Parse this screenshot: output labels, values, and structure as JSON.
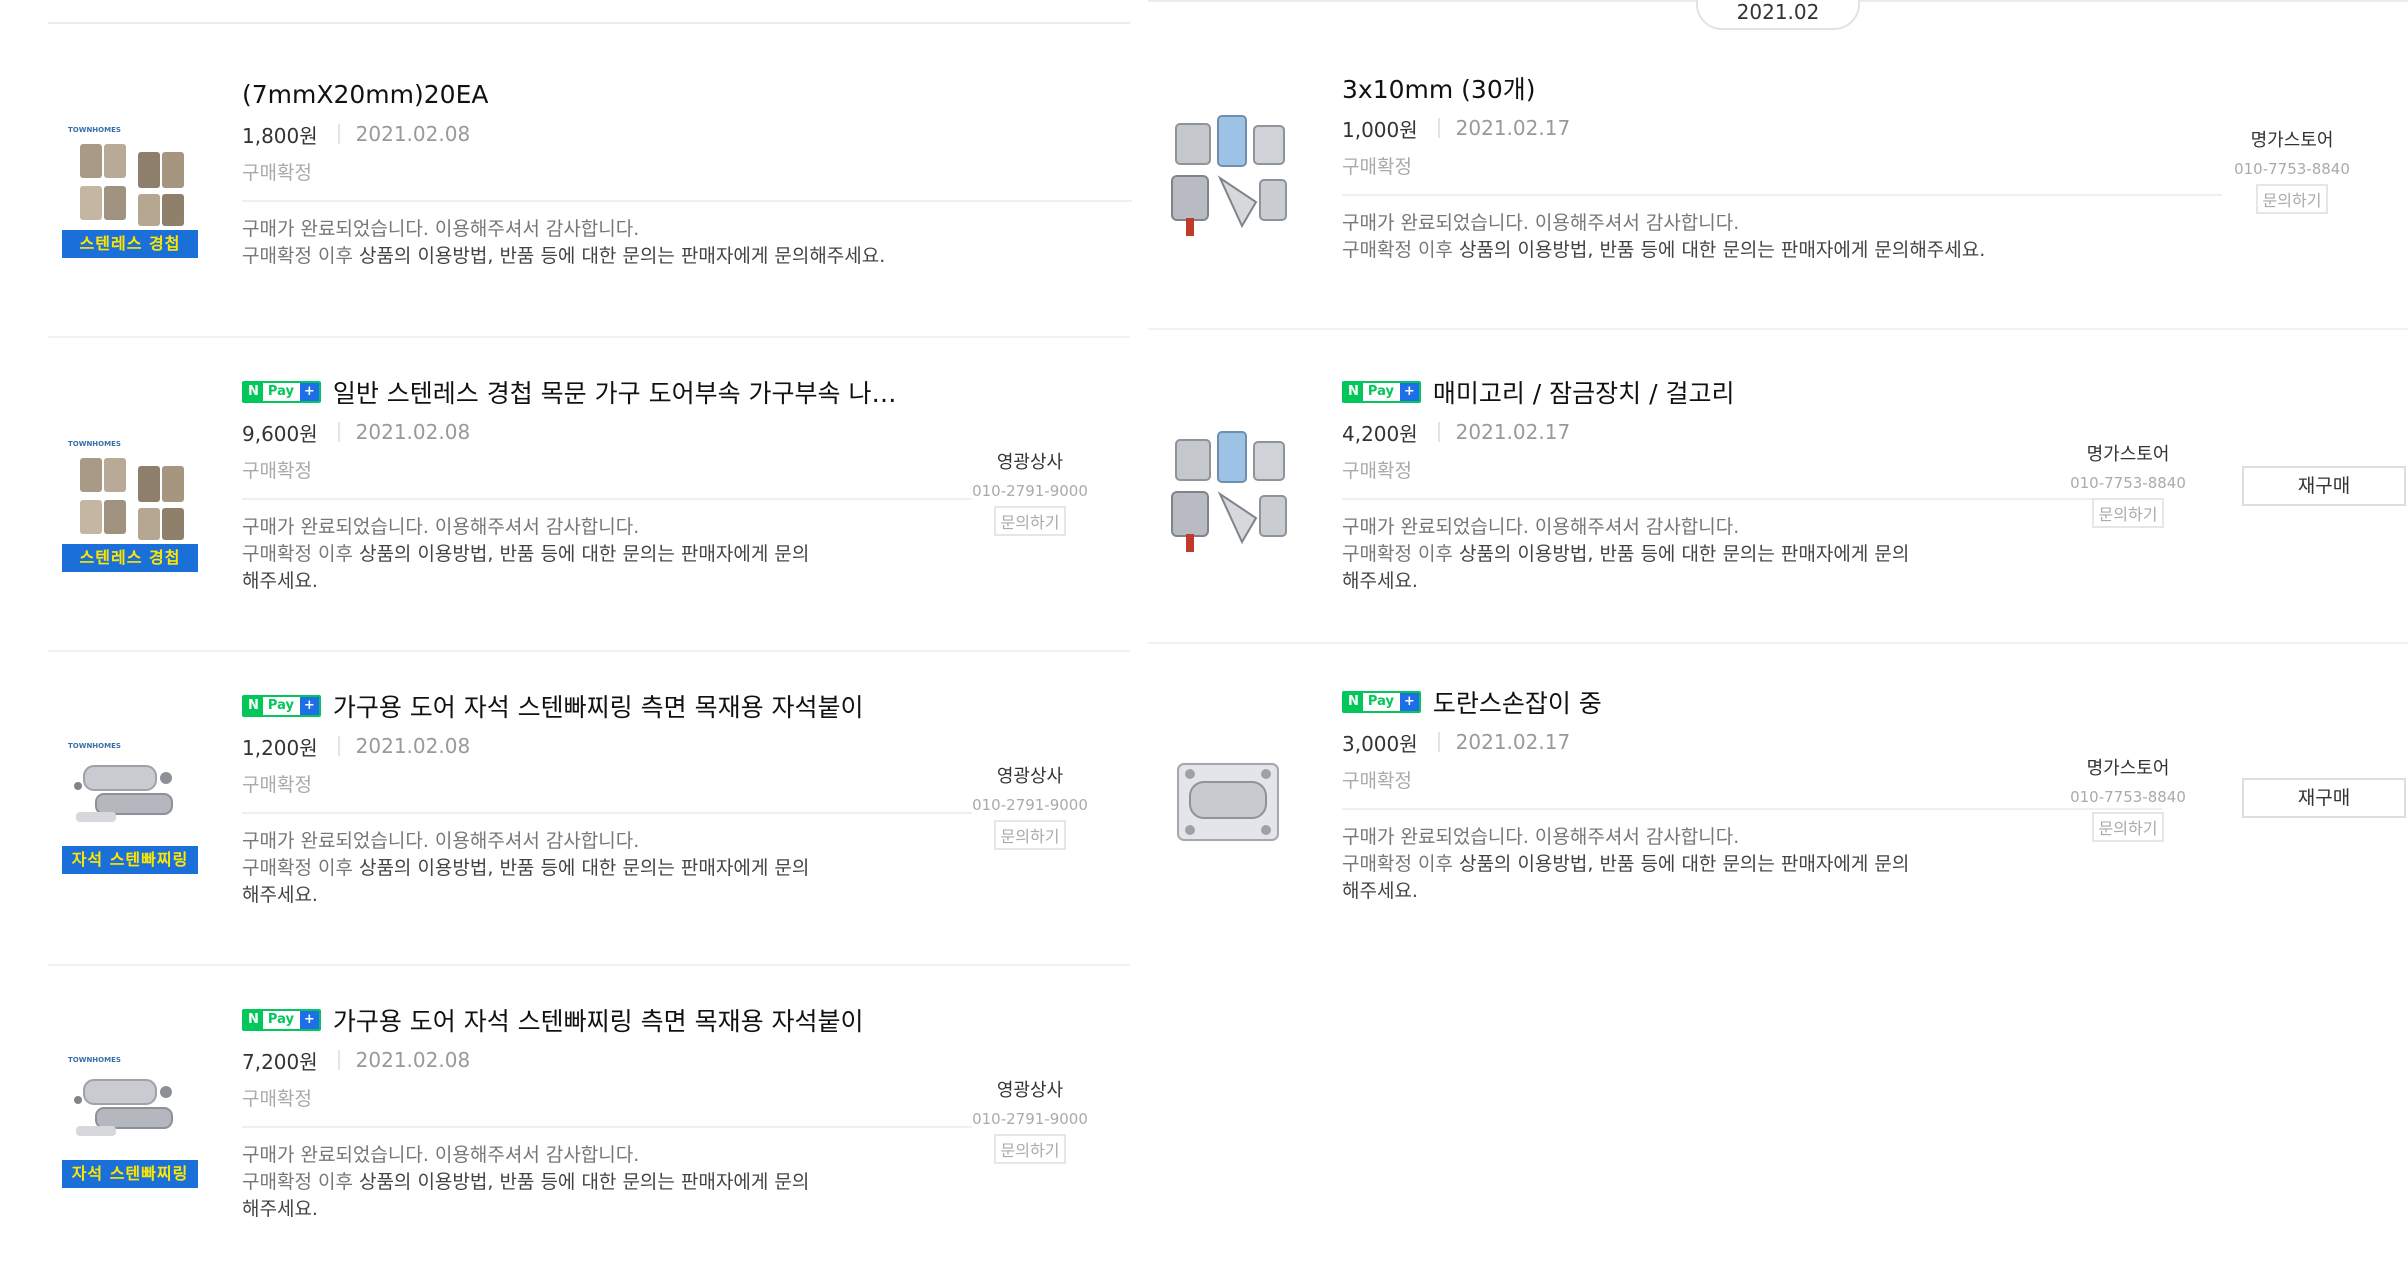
{
  "month_label": "2021.02",
  "npay_badge": {
    "n": "N",
    "pay": "Pay",
    "plus": "+"
  },
  "left_orders": [
    {
      "title": "(7mmX20mm)20EA",
      "has_npay": false,
      "price": "1,800원",
      "date": "2021.02.08",
      "status": "구매확정",
      "message_line1": "구매가 완료되었습니다. 이용해주셔서 감사합니다.",
      "message_line2_pre": "구매확정 이후 ",
      "message_line2_bold": "상품의 이용방법, 반품 등에 대한 문의는 판매자에게 문의해주세요.",
      "message_line3": "",
      "thumb_tag": "스텐레스 경첩",
      "thumb_brand": "TOWNHOMES",
      "seller": null
    },
    {
      "title": "일반 스텐레스 경첩 목문 가구 도어부속 가구부속 나…",
      "has_npay": true,
      "price": "9,600원",
      "date": "2021.02.08",
      "status": "구매확정",
      "message_line1": "구매가 완료되었습니다. 이용해주셔서 감사합니다.",
      "message_line2_pre": "구매확정 이후 ",
      "message_line2_bold": "상품의 이용방법, 반품 등에 대한 문의는 판매자에게 문의",
      "message_line3": "해주세요.",
      "thumb_tag": "스텐레스 경첩",
      "thumb_brand": "TOWNHOMES",
      "seller": {
        "name": "영광상사",
        "phone": "010-2791-9000",
        "ask": "문의하기"
      }
    },
    {
      "title": "가구용 도어 자석 스텐빠찌링 측면 목재용 자석붙이",
      "has_npay": true,
      "price": "1,200원",
      "date": "2021.02.08",
      "status": "구매확정",
      "message_line1": "구매가 완료되었습니다. 이용해주셔서 감사합니다.",
      "message_line2_pre": "구매확정 이후 ",
      "message_line2_bold": "상품의 이용방법, 반품 등에 대한 문의는 판매자에게 문의",
      "message_line3": "해주세요.",
      "thumb_tag": "자석 스텐빠찌링",
      "thumb_brand": "TOWNHOMES",
      "seller": {
        "name": "영광상사",
        "phone": "010-2791-9000",
        "ask": "문의하기"
      }
    },
    {
      "title": "가구용 도어 자석 스텐빠찌링 측면 목재용 자석붙이",
      "has_npay": true,
      "price": "7,200원",
      "date": "2021.02.08",
      "status": "구매확정",
      "message_line1": "구매가 완료되었습니다. 이용해주셔서 감사합니다.",
      "message_line2_pre": "구매확정 이후 ",
      "message_line2_bold": "상품의 이용방법, 반품 등에 대한 문의는 판매자에게 문의",
      "message_line3": "해주세요.",
      "thumb_tag": "자석 스텐빠찌링",
      "thumb_brand": "TOWNHOMES",
      "seller": {
        "name": "영광상사",
        "phone": "010-2791-9000",
        "ask": "문의하기"
      }
    }
  ],
  "right_orders": [
    {
      "title": "3x10mm (30개)",
      "has_npay": false,
      "price": "1,000원",
      "date": "2021.02.17",
      "status": "구매확정",
      "message_line1": "구매가 완료되었습니다. 이용해주셔서 감사합니다.",
      "message_line2_pre": "구매확정 이후 ",
      "message_line2_bold": "상품의 이용방법, 반품 등에 대한 문의는 판매자에게 문의해주세요.",
      "message_line3": "",
      "seller": {
        "name": "명가스토어",
        "phone": "010-7753-8840",
        "ask": "문의하기"
      },
      "rebuy": null
    },
    {
      "title": "매미고리 / 잠금장치 / 걸고리",
      "has_npay": true,
      "price": "4,200원",
      "date": "2021.02.17",
      "status": "구매확정",
      "message_line1": "구매가 완료되었습니다. 이용해주셔서 감사합니다.",
      "message_line2_pre": "구매확정 이후 ",
      "message_line2_bold": "상품의 이용방법, 반품 등에 대한 문의는 판매자에게 문의",
      "message_line3": "해주세요.",
      "seller": {
        "name": "명가스토어",
        "phone": "010-7753-8840",
        "ask": "문의하기"
      },
      "rebuy": "재구매"
    },
    {
      "title": "도란스손잡이 중",
      "has_npay": true,
      "price": "3,000원",
      "date": "2021.02.17",
      "status": "구매확정",
      "message_line1": "구매가 완료되었습니다. 이용해주셔서 감사합니다.",
      "message_line2_pre": "구매확정 이후 ",
      "message_line2_bold": "상품의 이용방법, 반품 등에 대한 문의는 판매자에게 문의",
      "message_line3": "해주세요.",
      "seller": {
        "name": "명가스토어",
        "phone": "010-7753-8840",
        "ask": "문의하기"
      },
      "rebuy": "재구매"
    }
  ]
}
